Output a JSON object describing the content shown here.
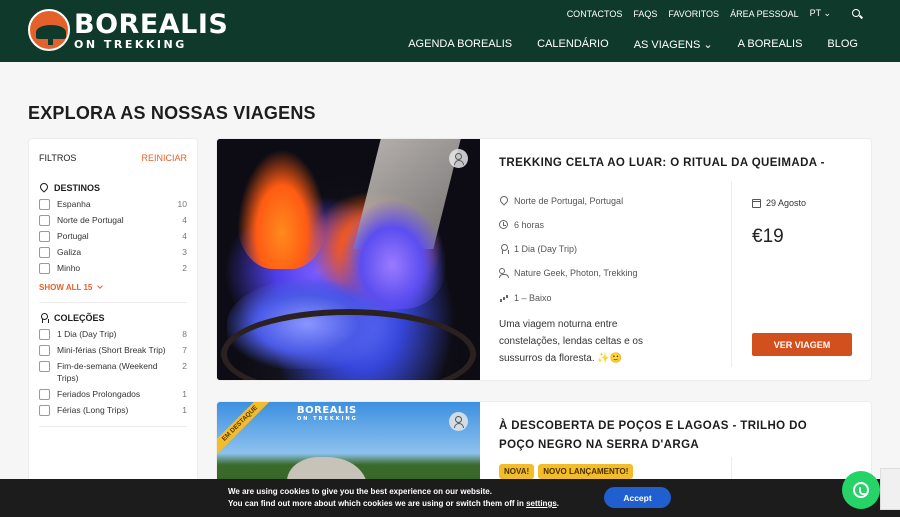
{
  "brand": {
    "name": "BOREALIS",
    "tagline": "ON TREKKING"
  },
  "topnav": {
    "contactos": "CONTACTOS",
    "faqs": "FAQS",
    "favoritos": "FAVORITOS",
    "area": "ÁREA PESSOAL",
    "lang": "PT"
  },
  "mainnav": {
    "agenda": "AGENDA BOREALIS",
    "calendario": "CALENDÁRIO",
    "viagens": "AS VIAGENS",
    "aborealis": "A BOREALIS",
    "blog": "BLOG"
  },
  "page": {
    "title": "EXPLORA AS NOSSAS VIAGENS"
  },
  "filters": {
    "title": "FILTROS",
    "reset": "REINICIAR",
    "destinos": {
      "title": "DESTINOS",
      "items": [
        {
          "label": "Espanha",
          "count": "10"
        },
        {
          "label": "Norte de Portugal",
          "count": "4"
        },
        {
          "label": "Portugal",
          "count": "4"
        },
        {
          "label": "Galiza",
          "count": "3"
        },
        {
          "label": "Minho",
          "count": "2"
        }
      ],
      "show_all": "SHOW ALL 15"
    },
    "colecoes": {
      "title": "COLEÇÕES",
      "items": [
        {
          "label": "1 Dia (Day Trip)",
          "count": "8"
        },
        {
          "label": "Mini-férias (Short Break Trip)",
          "count": "7"
        },
        {
          "label": "Fim-de-semana (Weekend Trips)",
          "count": "2"
        },
        {
          "label": "Feriados Prolongados",
          "count": "1"
        },
        {
          "label": "Férias (Long Trips)",
          "count": "1"
        }
      ]
    }
  },
  "trips": [
    {
      "title": "TREKKING CELTA AO LUAR: O RITUAL DA QUEIMADA -",
      "location": "Norte de Portugal, Portugal",
      "duration": "6 horas",
      "collection": "1 Dia (Day Trip)",
      "types": "Nature Geek, Photon, Trekking",
      "level": "1 – Baixo",
      "description": "Uma viagem noturna entre constelações, lendas celtas e os sussurros da floresta. ✨🙂",
      "date": "29 Agosto",
      "price": "€19",
      "button": "VER VIAGEM"
    },
    {
      "ribbon": "EM DESTAQUE",
      "title": "À DESCOBERTA DE POÇOS E LAGOAS - TRILHO DO POÇO NEGRO NA SERRA D'ARGA",
      "tags": [
        "NOVA!",
        "NOVO LANÇAMENTO!"
      ],
      "image_logo": "BOREALIS",
      "image_logo_sub": "ON TREKKING"
    }
  ],
  "cookie": {
    "line1": "We are using cookies to give you the best experience on our website.",
    "line2_prefix": "You can find out more about which cookies we are using or switch them off in ",
    "line2_link": "settings",
    "line2_suffix": ".",
    "accept": "Accept"
  },
  "colors": {
    "header": "#0f3a2b",
    "accent": "#e5612c",
    "button": "#d24f1e",
    "tag": "#f3bc2a",
    "whatsapp": "#25d366"
  }
}
